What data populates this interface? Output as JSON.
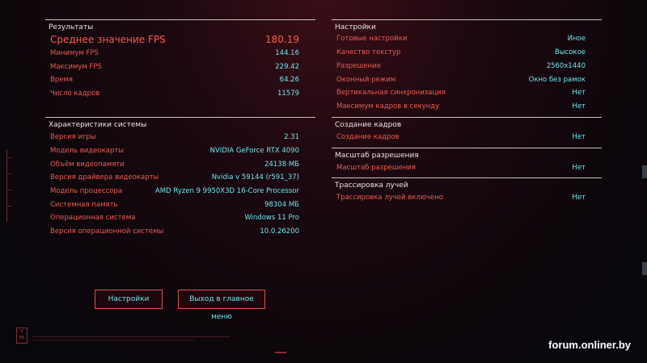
{
  "results": {
    "header": "Результаты",
    "rows": [
      {
        "label": "Среднее значение FPS",
        "value": "180.19"
      },
      {
        "label": "Минимум FPS",
        "value": "144.16"
      },
      {
        "label": "Максимум FPS",
        "value": "229.42"
      },
      {
        "label": "Время",
        "value": "64.26"
      },
      {
        "label": "Число кадров",
        "value": "11579"
      }
    ]
  },
  "system": {
    "header": "Характеристики системы",
    "rows": [
      {
        "label": "Версия игры",
        "value": "2.31"
      },
      {
        "label": "Модель видеокарты",
        "value": "NVIDIA GeForce RTX 4090"
      },
      {
        "label": "Объём видеопамяти",
        "value": "24138 МБ"
      },
      {
        "label": "Версия драйвера видеокарты",
        "value": "Nvidia v 59144 (r591_37)"
      },
      {
        "label": "Модель процессора",
        "value": "AMD Ryzen 9 9950X3D 16-Core Processor"
      },
      {
        "label": "Системная память",
        "value": "98304 МБ"
      },
      {
        "label": "Операционная система",
        "value": "Windows 11 Pro"
      },
      {
        "label": "Версия операционной системы",
        "value": "10.0.26200"
      }
    ]
  },
  "settings": {
    "header": "Настройки",
    "rows": [
      {
        "label": "Готовые настройки",
        "value": "Иное"
      },
      {
        "label": "Качество текстур",
        "value": "Высокое"
      },
      {
        "label": "Разрешение",
        "value": "2560x1440"
      },
      {
        "label": "Оконный режим",
        "value": "Окно без рамок"
      },
      {
        "label": "Вертикальная синхронизация",
        "value": "Нет"
      },
      {
        "label": "Максимум кадров в секунду",
        "value": "Нет"
      }
    ]
  },
  "frame_gen": {
    "header": "Создание кадров",
    "rows": [
      {
        "label": "Создание кадров",
        "value": "Нет"
      }
    ]
  },
  "res_scaling": {
    "header": "Масштаб разрешения",
    "rows": [
      {
        "label": "Масштаб разрешения",
        "value": "Нет"
      }
    ]
  },
  "ray_tracing": {
    "header": "Трассировка лучей",
    "rows": [
      {
        "label": "Трассировка лучей включено",
        "value": "Нет"
      }
    ]
  },
  "buttons": {
    "settings": "Настройки",
    "main_menu": "Выход в главное меню"
  },
  "watermark": "forum.onliner.by",
  "colors": {
    "label": "#ec5d4f",
    "value": "#6fe5ee",
    "header": "#e8e6e0",
    "accent": "#d9534c"
  }
}
